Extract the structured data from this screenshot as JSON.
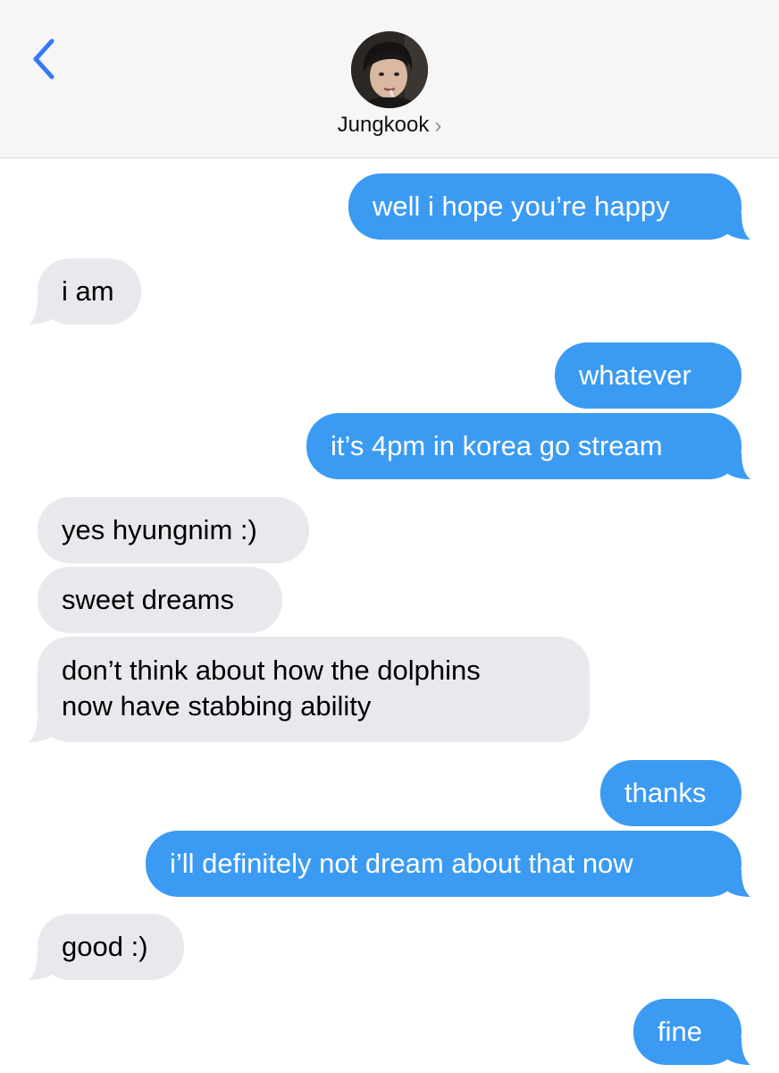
{
  "header": {
    "contact_name": "Jungkook",
    "name_chevron": "›",
    "back_icon": "chevron-left-icon",
    "accent_color": "#3478f6"
  },
  "colors": {
    "outgoing_bubble": "#3b9bf3",
    "incoming_bubble": "#e8e8ed",
    "header_bg": "#f6f6f7"
  },
  "messages": [
    {
      "direction": "outgoing",
      "text": "well i hope you’re happy"
    },
    {
      "direction": "incoming",
      "text": "i am"
    },
    {
      "direction": "outgoing",
      "text": "whatever"
    },
    {
      "direction": "outgoing",
      "text": "it’s 4pm in korea go stream"
    },
    {
      "direction": "incoming",
      "text": "yes hyungnim :)"
    },
    {
      "direction": "incoming",
      "text": "sweet dreams"
    },
    {
      "direction": "incoming",
      "lines": [
        "don’t think about how the dolphins",
        "now have stabbing ability"
      ]
    },
    {
      "direction": "outgoing",
      "text": "thanks"
    },
    {
      "direction": "outgoing",
      "text": "i’ll definitely not dream about that now"
    },
    {
      "direction": "incoming",
      "text": "good :)"
    },
    {
      "direction": "outgoing",
      "text": "fine"
    }
  ]
}
